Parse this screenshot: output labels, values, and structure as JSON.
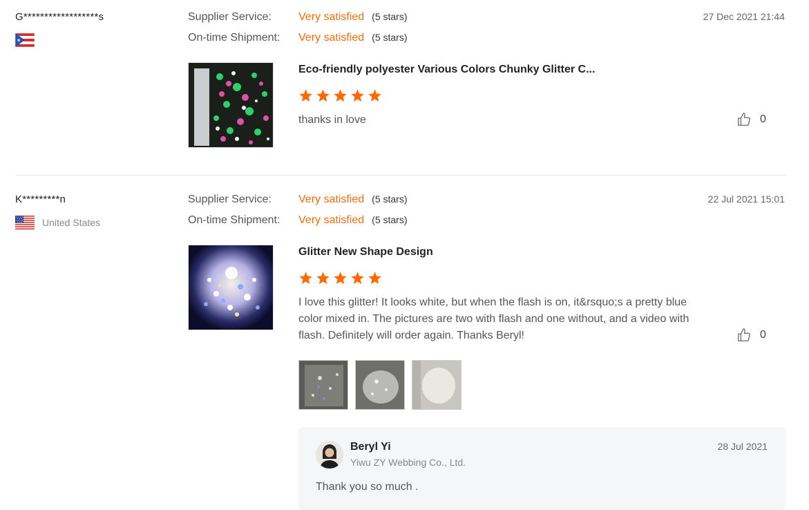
{
  "labels": {
    "supplier_service": "Supplier Service:",
    "ontime_shipment": "On-time Shipment:"
  },
  "reviews": [
    {
      "user": "G******************s",
      "country": "",
      "flag": "puerto-rico-flag",
      "supplier_service": {
        "value": "Very satisfied",
        "stars": "(5 stars)"
      },
      "ontime_shipment": {
        "value": "Very satisfied",
        "stars": "(5 stars)"
      },
      "date": "27 Dec 2021 21:44",
      "product_title": "Eco-friendly polyester Various Colors Chunky Glitter C...",
      "rating": 5,
      "comment": "thanks in love",
      "likes": "0"
    },
    {
      "user": "K*********n",
      "country": "United States",
      "flag": "united-states-flag",
      "supplier_service": {
        "value": "Very satisfied",
        "stars": "(5 stars)"
      },
      "ontime_shipment": {
        "value": "Very satisfied",
        "stars": "(5 stars)"
      },
      "date": "22 Jul 2021 15:01",
      "product_title": "Glitter New Shape Design",
      "rating": 5,
      "comment": "I love this glitter! It looks white, but when the flash is on, it&rsquo;s a pretty blue color mixed in. The pictures are two with flash and one without, and a video with flash. Definitely will order again. Thanks Beryl!",
      "likes": "0",
      "reply": {
        "name": "Beryl Yi",
        "company": "Yiwu ZY Webbing Co., Ltd.",
        "date": "28 Jul 2021",
        "text": "Thank you so much ."
      }
    }
  ],
  "colors": {
    "accent": "#ff6a00",
    "reply_bg": "#f5f6f8"
  },
  "icons": {
    "star": "star-icon",
    "like": "thumbs-up-icon"
  }
}
